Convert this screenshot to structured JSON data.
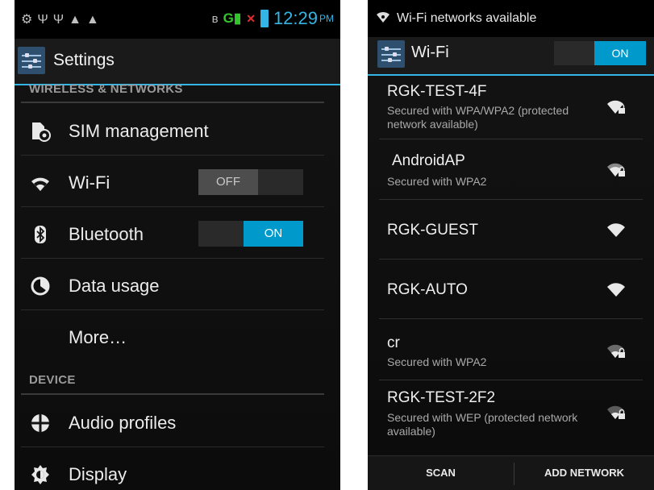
{
  "left": {
    "status_bar": {
      "icons": [
        "usb-debug-icon",
        "usb-icon",
        "usb-icon",
        "warning-icon",
        "warning-icon",
        "bluetooth-icon",
        "signal-icon",
        "no-sim-icon",
        "battery-icon"
      ],
      "network_type": "G",
      "time": "12:29",
      "ampm": "PM"
    },
    "action_bar": {
      "title": "Settings"
    },
    "sections": {
      "wireless": "WIRELESS & NETWORKS",
      "device": "DEVICE"
    },
    "items": [
      {
        "label": "SIM management",
        "icon": "sim-management-icon"
      },
      {
        "label": "Wi-Fi",
        "icon": "wifi-icon",
        "toggle": "OFF"
      },
      {
        "label": "Bluetooth",
        "icon": "bluetooth-icon",
        "toggle": "ON"
      },
      {
        "label": "Data usage",
        "icon": "data-usage-icon"
      },
      {
        "label": "More…"
      },
      {
        "label": "Audio profiles",
        "icon": "audio-profiles-icon"
      },
      {
        "label": "Display",
        "icon": "display-icon"
      }
    ]
  },
  "right": {
    "status_bar": {
      "notification": "Wi-Fi networks available"
    },
    "action_bar": {
      "title": "Wi-Fi",
      "toggle": "ON"
    },
    "networks": [
      {
        "ssid": "RGK-TEST-4F",
        "status": "Secured with WPA/WPA2 (protected network available)",
        "secured": true
      },
      {
        "ssid": "AndroidAP",
        "status": "Secured with WPA2",
        "secured": true
      },
      {
        "ssid": "RGK-GUEST",
        "status": "",
        "secured": false
      },
      {
        "ssid": "RGK-AUTO",
        "status": "",
        "secured": false
      },
      {
        "ssid": "cr",
        "status": "Secured with WPA2",
        "secured": true
      },
      {
        "ssid": "RGK-TEST-2F2",
        "status": "Secured with WEP (protected network available)",
        "secured": true
      }
    ],
    "buttons": {
      "scan": "SCAN",
      "add_network": "ADD NETWORK"
    }
  },
  "colors": {
    "accent": "#33b5e5",
    "toggle_on": "#0099cc",
    "background": "#0f0f0f"
  }
}
